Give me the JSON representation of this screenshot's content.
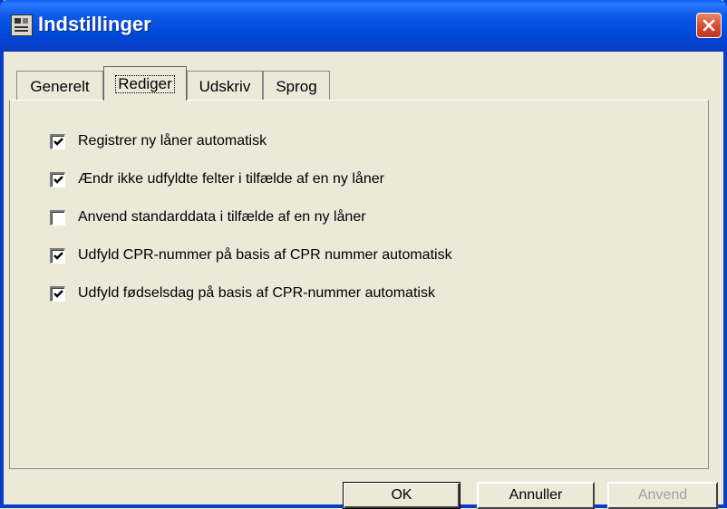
{
  "window": {
    "title": "Indstillinger"
  },
  "tabs": [
    {
      "label": "Generelt",
      "active": false
    },
    {
      "label": "Rediger",
      "active": true
    },
    {
      "label": "Udskriv",
      "active": false
    },
    {
      "label": "Sprog",
      "active": false
    }
  ],
  "options": [
    {
      "label": "Registrer ny låner automatisk",
      "checked": true
    },
    {
      "label": "Ændr ikke udfyldte felter i tilfælde af en ny låner",
      "checked": true
    },
    {
      "label": "Anvend standarddata i tilfælde af en ny låner",
      "checked": false
    },
    {
      "label": "Udfyld CPR-nummer på basis af CPR nummer automatisk",
      "checked": true
    },
    {
      "label": "Udfyld fødselsdag på basis af CPR-nummer automatisk",
      "checked": true
    }
  ],
  "buttons": {
    "ok": "OK",
    "cancel": "Annuller",
    "apply": "Anvend"
  }
}
